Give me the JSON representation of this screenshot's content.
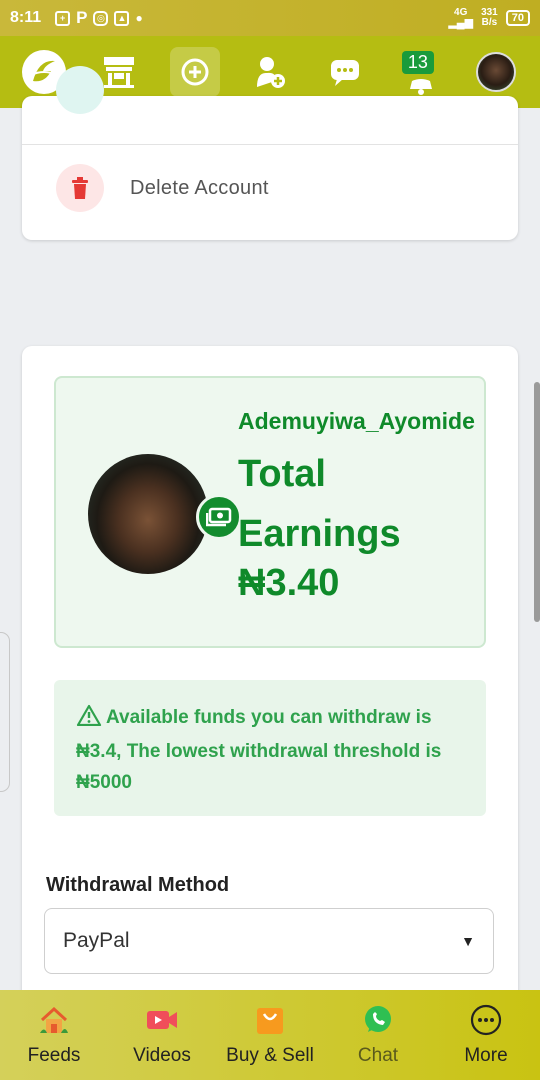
{
  "status_bar": {
    "time": "8:11",
    "net_type": "4G",
    "net_speed_value": "331",
    "net_speed_unit": "B/s",
    "battery": "70"
  },
  "toolbar": {
    "notification_count": "13",
    "icons": [
      "logo-icon",
      "store-icon",
      "add-icon",
      "add-user-icon",
      "chat-bubble-icon",
      "bell-icon",
      "profile-avatar"
    ]
  },
  "settings_card": {
    "delete_account_label": "Delete Account"
  },
  "earnings": {
    "username": "Ademuyiwa_Ayomide",
    "title": "Total Earnings",
    "amount": "₦3.40"
  },
  "alert": {
    "message": "Available funds you can withdraw is ₦3.4, The lowest withdrawal threshold is ₦5000"
  },
  "withdrawal": {
    "label": "Withdrawal Method",
    "selected": "PayPal"
  },
  "bottom_nav": {
    "items": [
      {
        "label": "Feeds",
        "icon": "home-icon"
      },
      {
        "label": "Videos",
        "icon": "video-icon"
      },
      {
        "label": "Buy & Sell",
        "icon": "shopping-bag-icon"
      },
      {
        "label": "Chat",
        "icon": "whatsapp-icon"
      },
      {
        "label": "More",
        "icon": "more-icon"
      }
    ]
  },
  "colors": {
    "toolbar": "#b5bd12",
    "earnings_green": "#0f8a2a",
    "alert_green": "#2fa24d",
    "delete_red": "#e53935"
  }
}
